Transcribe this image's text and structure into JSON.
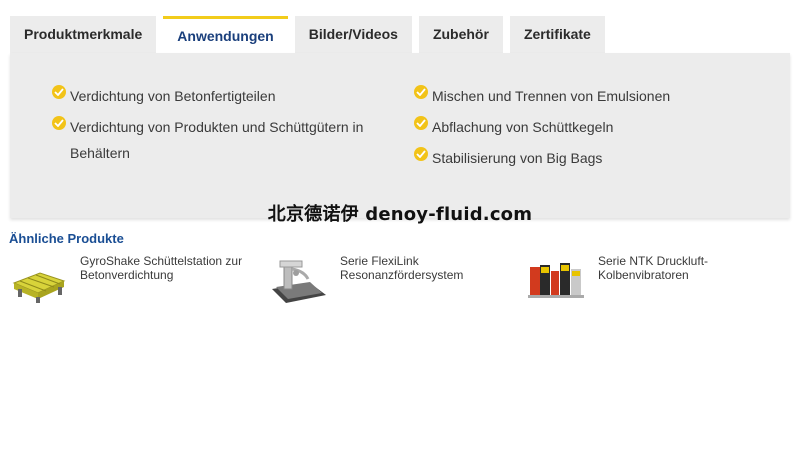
{
  "tabs": [
    {
      "label": "Produktmerkmale",
      "active": false
    },
    {
      "label": "Anwendungen",
      "active": true
    },
    {
      "label": "Bilder/Videos",
      "active": false
    },
    {
      "label": "Zubehör",
      "active": false
    },
    {
      "label": "Zertifikate",
      "active": false
    }
  ],
  "applications": {
    "left": [
      "Verdichtung von Betonfertigteilen",
      "Verdichtung von Produkten und Schüttgütern in Behältern"
    ],
    "right": [
      "Mischen und Trennen von Emulsionen",
      "Abflachung von Schüttkegeln",
      "Stabilisierung von Big Bags"
    ],
    "bullet_icon": "check-circle-icon",
    "accent_color": "#f2c318"
  },
  "watermark": "北京德诺伊 denoy-fluid.com",
  "similar_products": {
    "title": "Ähnliche Produkte",
    "items": [
      {
        "name": "GyroShake Schüttelstation zur Betonverdichtung",
        "image": "gyroshake-station-image"
      },
      {
        "name": "Serie FlexiLink Resonanzfördersystem",
        "image": "flexilink-conveyor-image"
      },
      {
        "name": "Serie NTK Druckluft-Kolbenvibratoren",
        "image": "ntk-vibrators-image"
      }
    ]
  },
  "colors": {
    "tab_active_text": "#1a3f7c",
    "tab_active_border": "#f2cc1b",
    "panel_bg": "#ececec",
    "link_blue": "#1a4e94"
  }
}
